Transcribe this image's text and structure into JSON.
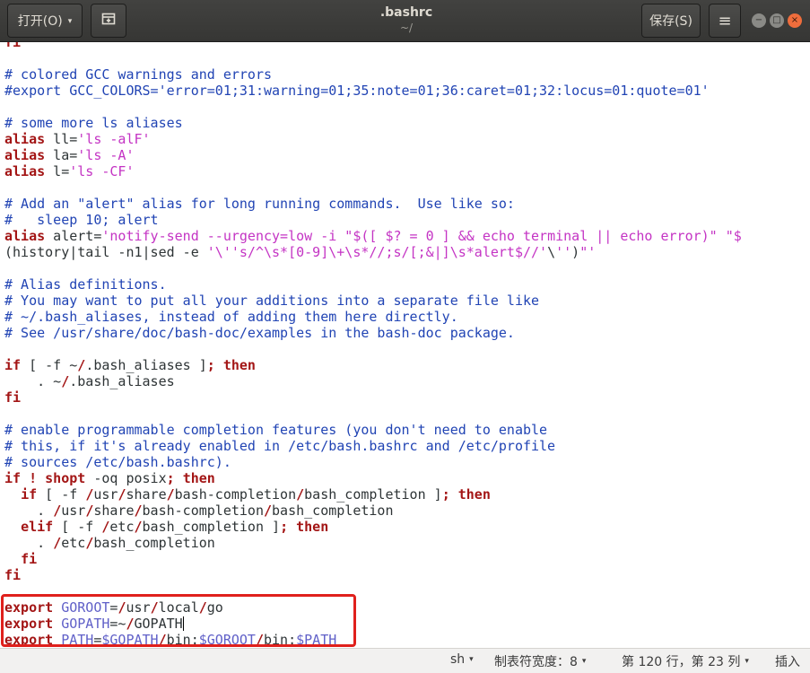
{
  "header": {
    "open_label": "打开(O)",
    "open_caret": "▾",
    "newtab_icon": "new-document-icon",
    "title": ".bashrc",
    "subtitle": "~/",
    "save_label": "保存(S)",
    "menu_icon": "hamburger-menu-icon",
    "menu_glyph": "≡",
    "minimize_glyph": "−",
    "maximize_glyph": "□",
    "close_glyph": "×"
  },
  "editor": {
    "lines": [
      "fi",
      "",
      "# colored GCC warnings and errors",
      "#export GCC_COLORS='error=01;31:warning=01;35:note=01;36:caret=01;32:locus=01:quote=01'",
      "",
      "# some more ls aliases",
      "alias ll='ls -alF'",
      "alias la='ls -A'",
      "alias l='ls -CF'",
      "",
      "# Add an \"alert\" alias for long running commands.  Use like so:",
      "#   sleep 10; alert",
      "alias alert='notify-send --urgency=low -i \"$([ $? = 0 ] && echo terminal || echo error)\" \"$",
      "(history|tail -n1|sed -e '\\''s/^\\s*[0-9]\\+\\s*//;s/[;&|]\\s*alert$//'\\'')\"'",
      "",
      "# Alias definitions.",
      "# You may want to put all your additions into a separate file like",
      "# ~/.bash_aliases, instead of adding them here directly.",
      "# See /usr/share/doc/bash-doc/examples in the bash-doc package.",
      "",
      "if [ -f ~/.bash_aliases ]; then",
      "    . ~/.bash_aliases",
      "fi",
      "",
      "# enable programmable completion features (you don't need to enable",
      "# this, if it's already enabled in /etc/bash.bashrc and /etc/profile",
      "# sources /etc/bash.bashrc).",
      "if ! shopt -oq posix; then",
      "  if [ -f /usr/share/bash-completion/bash_completion ]; then",
      "    . /usr/share/bash-completion/bash_completion",
      "  elif [ -f /etc/bash_completion ]; then",
      "    . /etc/bash_completion",
      "  fi",
      "fi",
      "",
      "export GOROOT=/usr/local/go",
      "export GOPATH=~/GOPATH",
      "export PATH=$GOPATH/bin:$GOROOT/bin:$PATH"
    ]
  },
  "statusbar": {
    "language": "sh",
    "tab_width": "制表符宽度：8",
    "position": "第 120 行，第 23 列",
    "mode": "插入",
    "caret": "▾"
  },
  "colors": {
    "comment": "#2144b4",
    "keyword": "#a31515",
    "string": "#c434c4",
    "variable": "#6060c8",
    "highlight_border": "#e0201c"
  }
}
